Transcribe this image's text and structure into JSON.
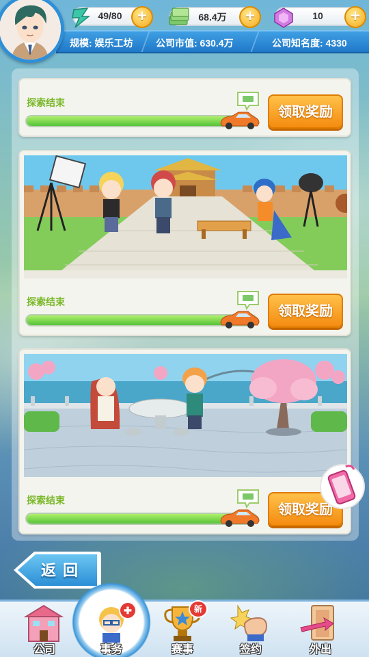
{
  "hud": {
    "energy": "49/80",
    "cash": "68.4万",
    "gems": "10",
    "plus_symbol": "+",
    "scale_label": "规模: 娱乐工坊",
    "market_value_label": "公司市值: 630.4万",
    "popularity_label": "公司知名度: 4330"
  },
  "cards": [
    {
      "status": "探索结束",
      "claim_label": "领取奖励",
      "progress": 1.0,
      "scene": "none"
    },
    {
      "status": "探索结束",
      "claim_label": "领取奖励",
      "progress": 1.0,
      "scene": "film-set"
    },
    {
      "status": "探索结束",
      "claim_label": "领取奖励",
      "progress": 1.0,
      "scene": "lakeside-garden"
    }
  ],
  "back_button": {
    "label": "返回"
  },
  "nav": {
    "items": [
      {
        "label": "公司",
        "icon": "company-building-icon"
      },
      {
        "label": "事务",
        "icon": "affairs-character-icon",
        "active": true,
        "badge": "gift"
      },
      {
        "label": "赛事",
        "icon": "trophy-icon",
        "badge": "新"
      },
      {
        "label": "签约",
        "icon": "contract-fist-icon"
      },
      {
        "label": "外出",
        "icon": "door-arrow-icon"
      }
    ]
  },
  "colors": {
    "accent_blue": "#2f8fd8",
    "progress_green": "#56c23a",
    "claim_orange": "#f48c10",
    "status_green": "#7ab82a",
    "badge_red": "#e53935"
  }
}
